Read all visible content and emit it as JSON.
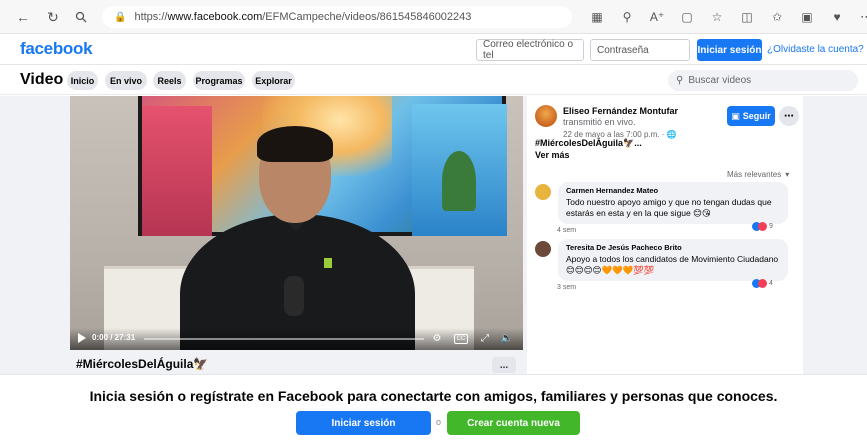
{
  "browser": {
    "url_prefix": "https://",
    "url_host": "www.facebook.com",
    "url_path": "/EFMCampeche/videos/861545846002243",
    "icons": [
      "back-icon",
      "refresh-icon",
      "search-icon",
      "lock-icon",
      "reader-icon",
      "zoom-icon",
      "read-aloud-icon",
      "extension-icon",
      "favorite-icon",
      "split-screen-icon",
      "favorites-icon",
      "collections-icon",
      "browser-essentials-icon",
      "more-icon",
      "profile-icon"
    ]
  },
  "header": {
    "logo": "facebook",
    "email_placeholder": "Correo electrónico o tel",
    "password_placeholder": "Contraseña",
    "login_label": "Iniciar sesión",
    "forgot_label": "¿Olvidaste la cuenta?"
  },
  "video_nav": {
    "title": "Video",
    "chips": [
      "Inicio",
      "En vivo",
      "Reels",
      "Programas",
      "Explorar"
    ],
    "search_placeholder": "Buscar videos"
  },
  "player": {
    "time": "0:00 / 27:31",
    "progress": 0.0,
    "caption": "#MiércolesDelÁguila🦅",
    "more_label": "..."
  },
  "sidebar": {
    "author": "Eliseo Fernández Montufar",
    "action": "transmitió en vivo.",
    "date": "22 de mayo a las 7:00 p.m. · 🌐",
    "follow_label": "Seguir",
    "hashtag": "#MiércolesDelÁguila🦅...",
    "see_more": "Ver más",
    "relevance_label": "Más relevantes",
    "comments": [
      {
        "author": "Carmen Hernandez Mateo",
        "text": "Todo nuestro apoyo amigo y que no tengan dudas que estarás en esta y en la que sigue 😊😘",
        "time": "4 sem",
        "reactions": "9",
        "avatar_color": "#e8b43c"
      },
      {
        "author": "Teresita De Jesús Pacheco Brito",
        "text": "Apoyo a todos los candidatos de Movimiento Ciudadano 😊😊😊😊🧡🧡🧡💯💯",
        "time": "3 sem",
        "reactions": "4",
        "avatar_color": "#6b4a3a"
      }
    ]
  },
  "banner": {
    "text": "Inicia sesión o regístrate en Facebook para conectarte con amigos, familiares y personas que conoces.",
    "login_label": "Iniciar sesión",
    "or_label": "o",
    "create_label": "Crear cuenta nueva"
  },
  "colors": {
    "brand": "#1877f2",
    "green": "#42b72a"
  }
}
